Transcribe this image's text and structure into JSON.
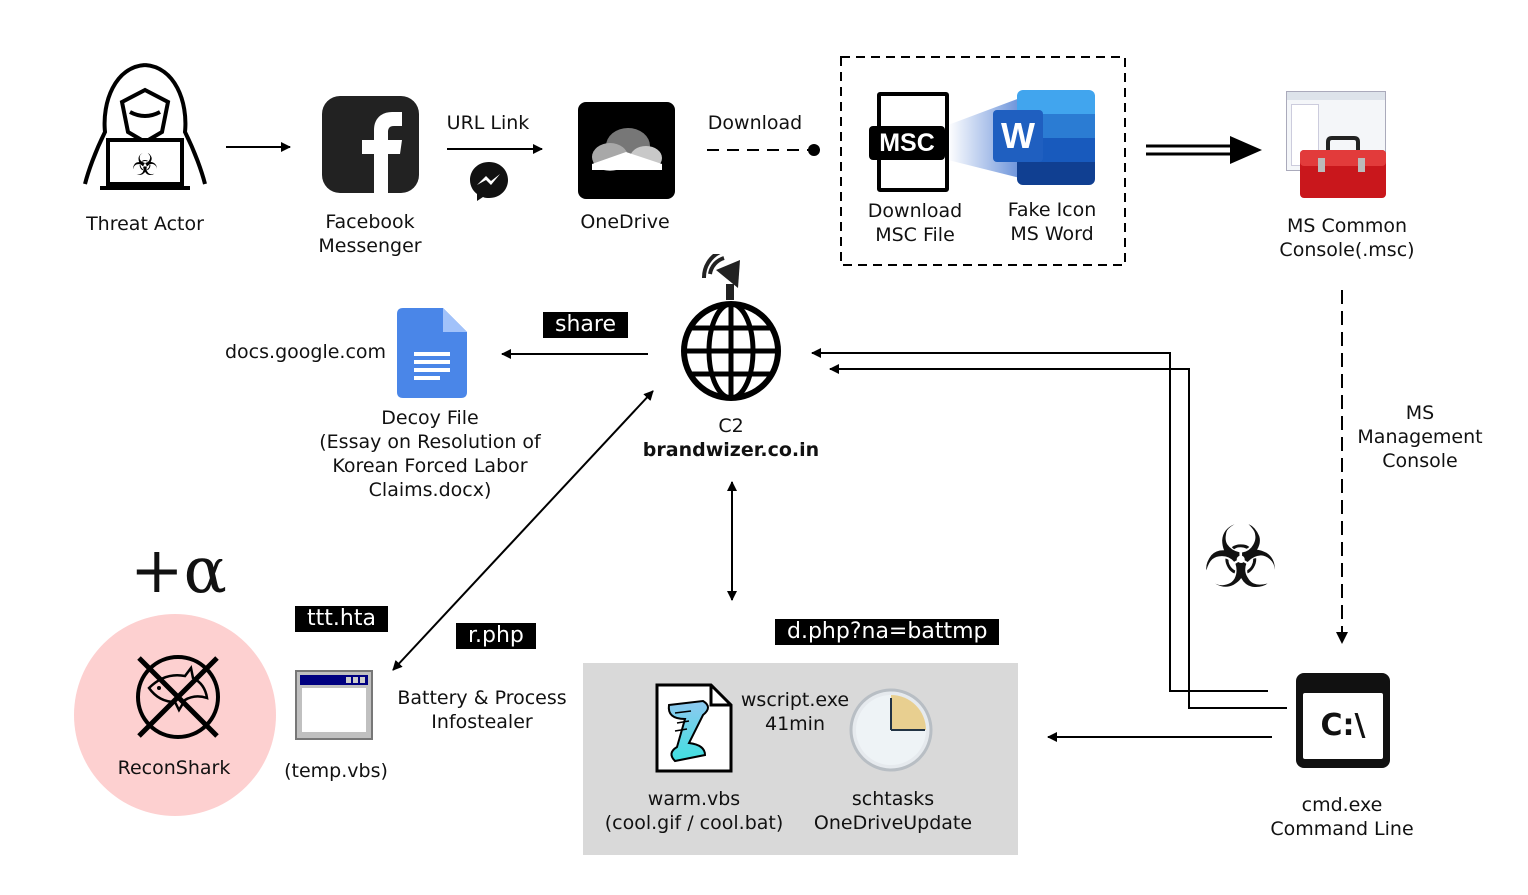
{
  "nodes": {
    "threat_actor": {
      "label": "Threat Actor"
    },
    "facebook": {
      "label_line1": "Facebook",
      "label_line2": "Messenger"
    },
    "url_link": {
      "label": "URL Link"
    },
    "onedrive": {
      "label": "OneDrive"
    },
    "download_edge": {
      "label": "Download"
    },
    "msc_file": {
      "icon_text": "MSC",
      "label_line1": "Download",
      "label_line2": "MSC File"
    },
    "fake_word": {
      "icon_text": "W",
      "label_line1": "Fake Icon",
      "label_line2": "MS Word"
    },
    "ms_console": {
      "label_line1": "MS Common",
      "label_line2": "Console(.msc)"
    },
    "mmc_edge": {
      "label_line1": "MS",
      "label_line2": "Management",
      "label_line3": "Console"
    },
    "google_docs": {
      "label": "docs.google.com"
    },
    "decoy": {
      "label_line1": "Decoy File",
      "label_line2": "(Essay on Resolution of",
      "label_line3": "Korean Forced Labor",
      "label_line4": "Claims.docx)"
    },
    "share_tag": {
      "label": "share"
    },
    "c2": {
      "label_line1": "C2",
      "label_line2": "brandwizer.co.in"
    },
    "alpha": {
      "label": "+α"
    },
    "reconshark": {
      "label": "ReconShark"
    },
    "ttt_tag": {
      "label": "ttt.hta"
    },
    "rphp_tag": {
      "label": "r.php"
    },
    "temp_vbs": {
      "label": "(temp.vbs)"
    },
    "infostealer": {
      "label_line1": "Battery & Process",
      "label_line2": "Infostealer"
    },
    "dphp_tag": {
      "label": "d.php?na=battmp"
    },
    "warm_vbs": {
      "label_line1": "warm.vbs",
      "label_line2": "(cool.gif / cool.bat)"
    },
    "wscript": {
      "label_line1": "wscript.exe",
      "label_line2": "41min"
    },
    "schtasks": {
      "label_line1": "schtasks",
      "label_line2": "OneDriveUpdate"
    },
    "cmd": {
      "icon_text": "C:\\",
      "label_line1": "cmd.exe",
      "label_line2": "Command Line"
    }
  },
  "colors": {
    "reconshark_bg": "#fdd0d0",
    "persistence_box_bg": "#d9d9d9",
    "word_blue": "#2b62c4",
    "docs_blue": "#4a86e8",
    "toolbox_red": "#d62a2a"
  }
}
